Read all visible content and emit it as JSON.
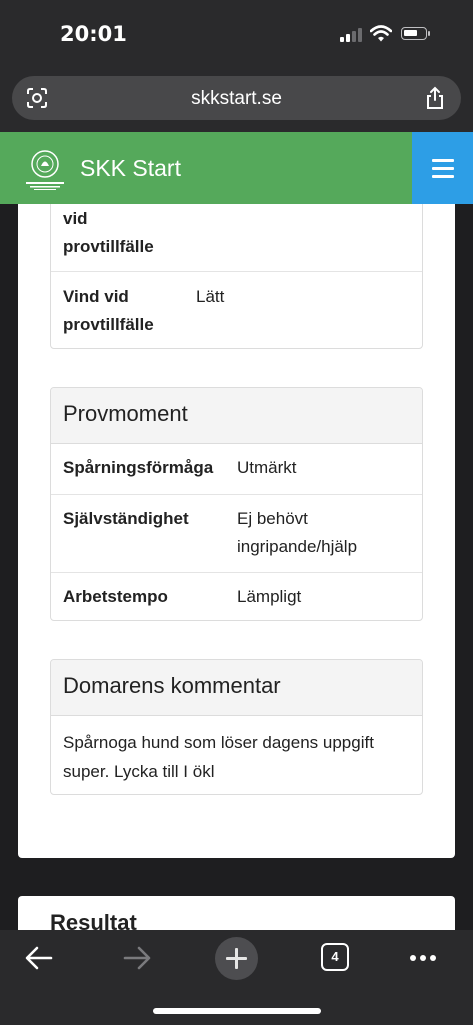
{
  "status_bar": {
    "time": "20:01"
  },
  "browser": {
    "url": "skkstart.se",
    "tab_count": "4"
  },
  "site": {
    "title": "SKK Start"
  },
  "conditions_panel": {
    "rows": [
      {
        "label": "vid\nprovtillfälle",
        "value": ""
      },
      {
        "label": "Vind vid\nprovtillfälle",
        "value": "Lätt"
      }
    ]
  },
  "provmoment": {
    "heading": "Provmoment",
    "rows": [
      {
        "label": "Spårningsförmåga",
        "value": "Utmärkt"
      },
      {
        "label": "Självständighet",
        "value": "Ej behövt\ningripande/hjälp"
      },
      {
        "label": "Arbetstempo",
        "value": "Lämpligt"
      }
    ]
  },
  "comment_panel": {
    "heading": "Domarens kommentar",
    "text": "Spårnoga hund som löser dagens uppgift super. Lycka till I ökl"
  },
  "result": {
    "heading": "Resultat"
  },
  "colors": {
    "header_green": "#55a95b",
    "menu_blue": "#2d9ee6"
  }
}
